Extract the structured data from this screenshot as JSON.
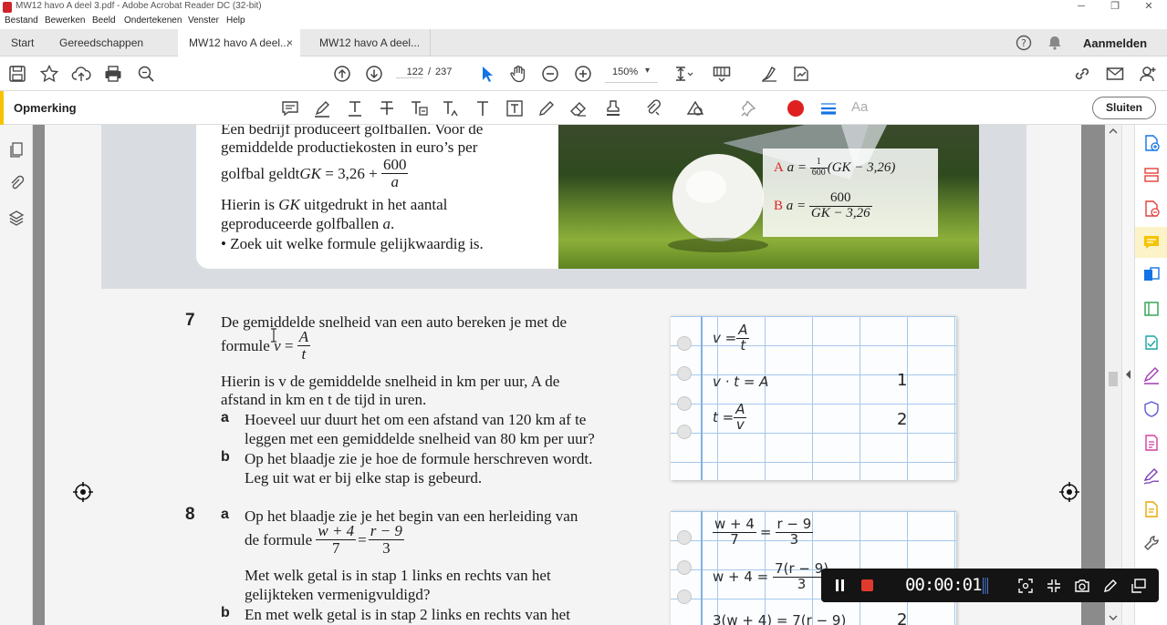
{
  "window": {
    "title": "MW12 havo A deel 3.pdf - Adobe Acrobat Reader DC (32-bit)",
    "minimize": "─",
    "maximize": "❐",
    "close": "✕"
  },
  "menu": [
    "Bestand",
    "Bewerken",
    "Beeld",
    "Ondertekenen",
    "Venster",
    "Help"
  ],
  "tabs": {
    "home": "Start",
    "tools": "Gereedschappen",
    "doc_active": "MW12 havo A deel...",
    "doc_active_close": "×",
    "doc_second": "MW12 havo A deel...",
    "signin": "Aanmelden",
    "help_icon": "help-circle-icon",
    "bell_icon": "bell-icon"
  },
  "toolbar": {
    "page_current": "122",
    "page_sep": "/",
    "page_total": "237",
    "zoom": "150%",
    "zoom_caret": "▾"
  },
  "comment_toolbar": {
    "label": "Opmerking",
    "close_label": "Sluiten",
    "accent_color": "#f5c400",
    "record_color": "#e02020",
    "font_label": "Aa"
  },
  "document": {
    "q6": {
      "line1": "Een bedrijf produceert golfballen. Voor de",
      "line2": "gemiddelde productiekosten in euro’s per",
      "formula_prefix": "golfbal geldt ",
      "formula_lhs": "GK",
      "formula_mid": " = 3,26 + ",
      "formula_num": "600",
      "formula_den": "a",
      "line4_a": "Hierin is ",
      "line4_var": "GK",
      "line4_b": " uitgedrukt in het aantal",
      "line5_a": "geproduceerde golfballen ",
      "line5_var": "a",
      "line5_b": ".",
      "line6": "• Zoek uit welke formule gelijkwaardig is.",
      "option_a_label": "A",
      "option_a_text": "a = ",
      "option_a_num": "1",
      "option_a_den": "600",
      "option_a_rest": "(GK − 3,26)",
      "option_b_label": "B",
      "option_b_text": "a = ",
      "option_b_num": "600",
      "option_b_den": "GK − 3,26"
    },
    "q7": {
      "number": "7",
      "line1": "De gemiddelde snelheid van een auto bereken je met de",
      "line2_a": "formule ",
      "line2_var": "v",
      "line2_eq": " = ",
      "line2_num": "A",
      "line2_den": "t",
      "line3": "Hierin is v de gemiddelde snelheid in km per uur, A de",
      "line4": "afstand in km en t de tijd in uren.",
      "a_label": "a",
      "a_line1": "Hoeveel uur duurt het om een afstand van 120 km af te",
      "a_line2": "leggen met een gemiddelde snelheid van 80 km per uur?",
      "b_label": "b",
      "b_line1": "Op het blaadje zie je hoe de formule herschreven wordt.",
      "b_line2": "Leg uit wat er bij elke stap is gebeurd.",
      "sheet": {
        "row1_lhs": "v =",
        "row1_num": "A",
        "row1_den": "t",
        "row2": "v · t = A",
        "row2_step": "1",
        "row3_lhs": "t =",
        "row3_num": "A",
        "row3_den": "v",
        "row3_step": "2"
      }
    },
    "q8": {
      "number": "8",
      "a_label": "a",
      "a_line1": "Op het blaadje zie je het begin van een herleiding van",
      "a_line2": "de formule ",
      "f_num1": "w + 4",
      "f_den1": "7",
      "f_eq": "=",
      "f_num2": "r − 9",
      "f_den2": "3",
      "a_line3": "Met welk getal is in stap 1 links en rechts van het",
      "a_line4": "gelijkteken vermenigvuldigd?",
      "b_label": "b",
      "b_line1": "En met welk getal is in stap 2 links en rechts van het",
      "sheet": {
        "row1_num1": "w + 4",
        "row1_den1": "7",
        "row1_eq": "=",
        "row1_num2": "r − 9",
        "row1_den2": "3",
        "row2_lhs": "w + 4 =",
        "row2_num": "7(r − 9)",
        "row2_den": "3",
        "row3": "3(w + 4) = 7(r − 9)",
        "row3_step": "2"
      }
    }
  },
  "recording": {
    "time": "00:00:01"
  }
}
